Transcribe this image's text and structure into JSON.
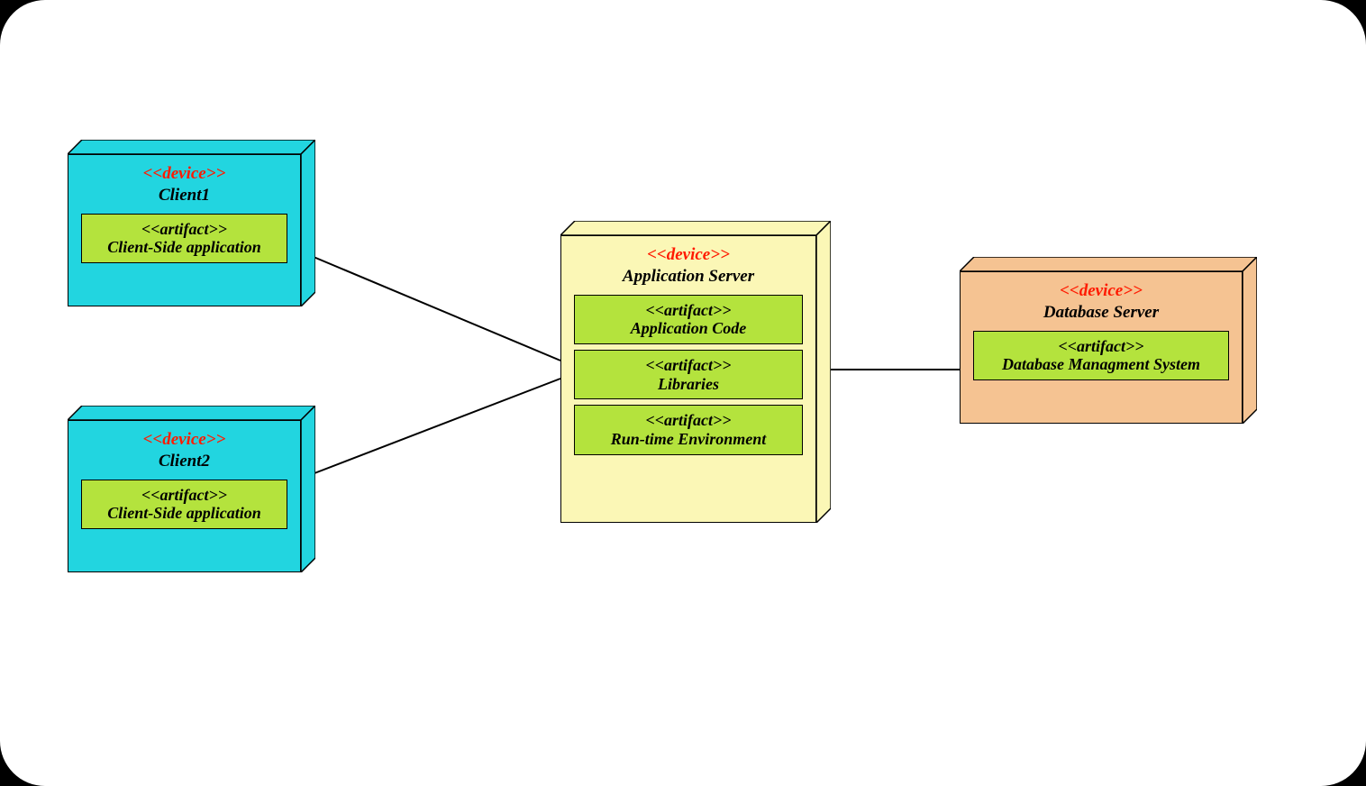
{
  "diagram": {
    "type": "UML Deployment Diagram",
    "nodes": {
      "client1": {
        "stereotype": "<<device>>",
        "title": "Client1",
        "artifacts": [
          {
            "stereotype": "<<artifact>>",
            "title": "Client-Side application"
          }
        ]
      },
      "client2": {
        "stereotype": "<<device>>",
        "title": "Client2",
        "artifacts": [
          {
            "stereotype": "<<artifact>>",
            "title": "Client-Side application"
          }
        ]
      },
      "appserver": {
        "stereotype": "<<device>>",
        "title": "Application Server",
        "artifacts": [
          {
            "stereotype": "<<artifact>>",
            "title": "Application Code"
          },
          {
            "stereotype": "<<artifact>>",
            "title": "Libraries"
          },
          {
            "stereotype": "<<artifact>>",
            "title": "Run-time Environment"
          }
        ]
      },
      "dbserver": {
        "stereotype": "<<device>>",
        "title": "Database Server",
        "artifacts": [
          {
            "stereotype": "<<artifact>>",
            "title": "Database Managment System"
          }
        ]
      }
    },
    "connections": [
      {
        "from": "client1",
        "to": "appserver"
      },
      {
        "from": "client2",
        "to": "appserver"
      },
      {
        "from": "appserver",
        "to": "dbserver"
      }
    ]
  }
}
